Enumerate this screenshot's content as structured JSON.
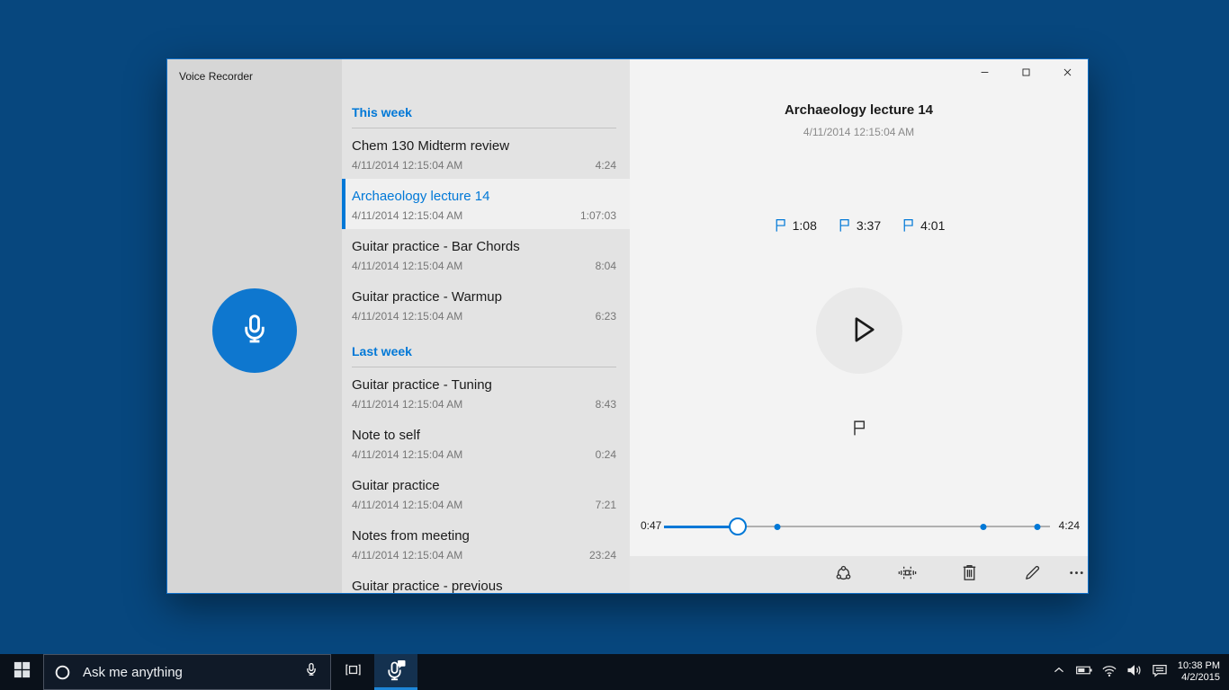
{
  "window": {
    "title": "Voice Recorder",
    "controls": [
      "minimize",
      "maximize",
      "close"
    ]
  },
  "list": {
    "sections": [
      {
        "label": "This week",
        "items": [
          {
            "title": "Chem 130 Midterm review",
            "datetime": "4/11/2014 12:15:04 AM",
            "duration": "4:24",
            "selected": false
          },
          {
            "title": "Archaeology lecture 14",
            "datetime": "4/11/2014 12:15:04 AM",
            "duration": "1:07:03",
            "selected": true
          },
          {
            "title": "Guitar practice - Bar Chords",
            "datetime": "4/11/2014 12:15:04 AM",
            "duration": "8:04",
            "selected": false
          },
          {
            "title": "Guitar practice - Warmup",
            "datetime": "4/11/2014 12:15:04 AM",
            "duration": "6:23",
            "selected": false
          }
        ]
      },
      {
        "label": "Last week",
        "items": [
          {
            "title": "Guitar practice - Tuning",
            "datetime": "4/11/2014 12:15:04 AM",
            "duration": "8:43",
            "selected": false
          },
          {
            "title": "Note to self",
            "datetime": "4/11/2014 12:15:04 AM",
            "duration": "0:24",
            "selected": false
          },
          {
            "title": "Guitar practice",
            "datetime": "4/11/2014 12:15:04 AM",
            "duration": "7:21",
            "selected": false
          },
          {
            "title": "Notes from meeting",
            "datetime": "4/11/2014 12:15:04 AM",
            "duration": "23:24",
            "selected": false
          },
          {
            "title": "Guitar practice - previous",
            "datetime": "",
            "duration": "",
            "selected": false
          }
        ]
      }
    ]
  },
  "detail": {
    "title": "Archaeology lecture 14",
    "datetime": "4/11/2014 12:15:04 AM",
    "flags": [
      "1:08",
      "3:37",
      "4:01"
    ],
    "slider": {
      "current": "0:47",
      "total": "4:24",
      "progress_pct": 19.1,
      "marker_pcts": [
        29.3,
        82.8,
        96.7
      ]
    }
  },
  "toolbar": {
    "icons": [
      "share-icon",
      "trim-icon",
      "delete-icon",
      "rename-icon",
      "more-icon"
    ]
  },
  "taskbar": {
    "search_placeholder": "Ask me anything",
    "clock": {
      "time": "10:38 PM",
      "date": "4/2/2015"
    }
  },
  "colors": {
    "accent": "#0078d7",
    "desktop": "#07477e",
    "taskbar": "#0a111a"
  }
}
